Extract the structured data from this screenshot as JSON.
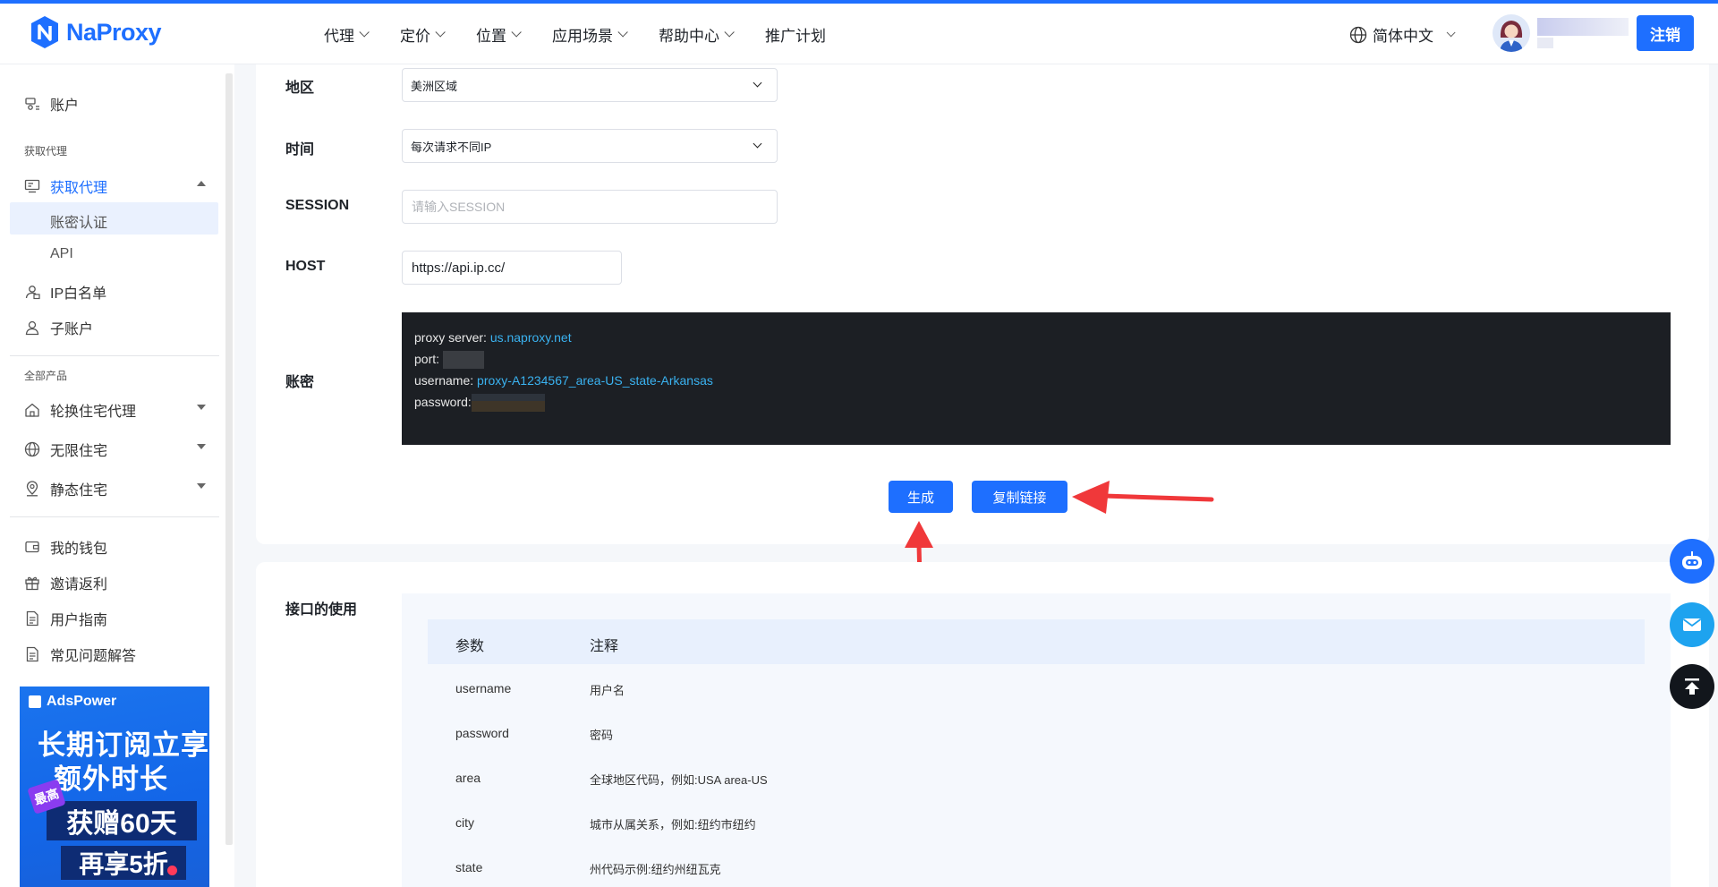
{
  "brand": {
    "name": "NaProxy",
    "color": "#1e6fff"
  },
  "nav": {
    "items": [
      {
        "label": "代理",
        "has_menu": true
      },
      {
        "label": "定价",
        "has_menu": true
      },
      {
        "label": "位置",
        "has_menu": true
      },
      {
        "label": "应用场景",
        "has_menu": true
      },
      {
        "label": "帮助中心",
        "has_menu": true
      },
      {
        "label": "推广计划",
        "has_menu": false
      }
    ],
    "language": "简体中文",
    "logout_label": "注销"
  },
  "sidebar": {
    "account": "账户",
    "group_get_proxy": "获取代理",
    "get_proxy": "获取代理",
    "sub_auth": "账密认证",
    "sub_api": "API",
    "ip_whitelist": "IP白名单",
    "sub_account": "子账户",
    "group_all_products": "全部产品",
    "rotating_residential": "轮换住宅代理",
    "unlimited_residential": "无限住宅",
    "static_residential": "静态住宅",
    "wallet": "我的钱包",
    "invite": "邀请返利",
    "guide": "用户指南",
    "faq": "常见问题解答",
    "ad": {
      "brand": "AdsPower",
      "line1": "长期订阅立享",
      "line2": "额外时长",
      "tag": "最高",
      "line3": "获赠60天",
      "line4": "再享5折"
    }
  },
  "form": {
    "region_label": "地区",
    "region_value": "美洲区域",
    "time_label": "时间",
    "time_value": "每次请求不同IP",
    "session_label": "SESSION",
    "session_placeholder": "请输入SESSION",
    "host_label": "HOST",
    "host_value": "https://api.ip.cc/",
    "credentials_label": "账密",
    "credentials": {
      "server_key": "proxy server: ",
      "server_value": "us.naproxy.net",
      "port_key": "port: ",
      "username_key": "username: ",
      "username_value": "proxy-A1234567_area-US_state-Arkansas",
      "password_key": "password:"
    },
    "generate_label": "生成",
    "copy_label": "复制链接"
  },
  "usage": {
    "title": "接口的使用",
    "columns": [
      "参数",
      "注释"
    ],
    "rows": [
      {
        "param": "username",
        "note": "用户名"
      },
      {
        "param": "password",
        "note": "密码"
      },
      {
        "param": "area",
        "note": "全球地区代码，例如:USA area-US"
      },
      {
        "param": "city",
        "note": "城市从属关系，例如:纽约市纽约"
      },
      {
        "param": "state",
        "note": "州代码示例:纽约州纽瓦克"
      }
    ]
  },
  "floating": {
    "bot_icon": "robot-icon",
    "mail_icon": "mail-icon",
    "top_icon": "back-to-top-icon"
  }
}
